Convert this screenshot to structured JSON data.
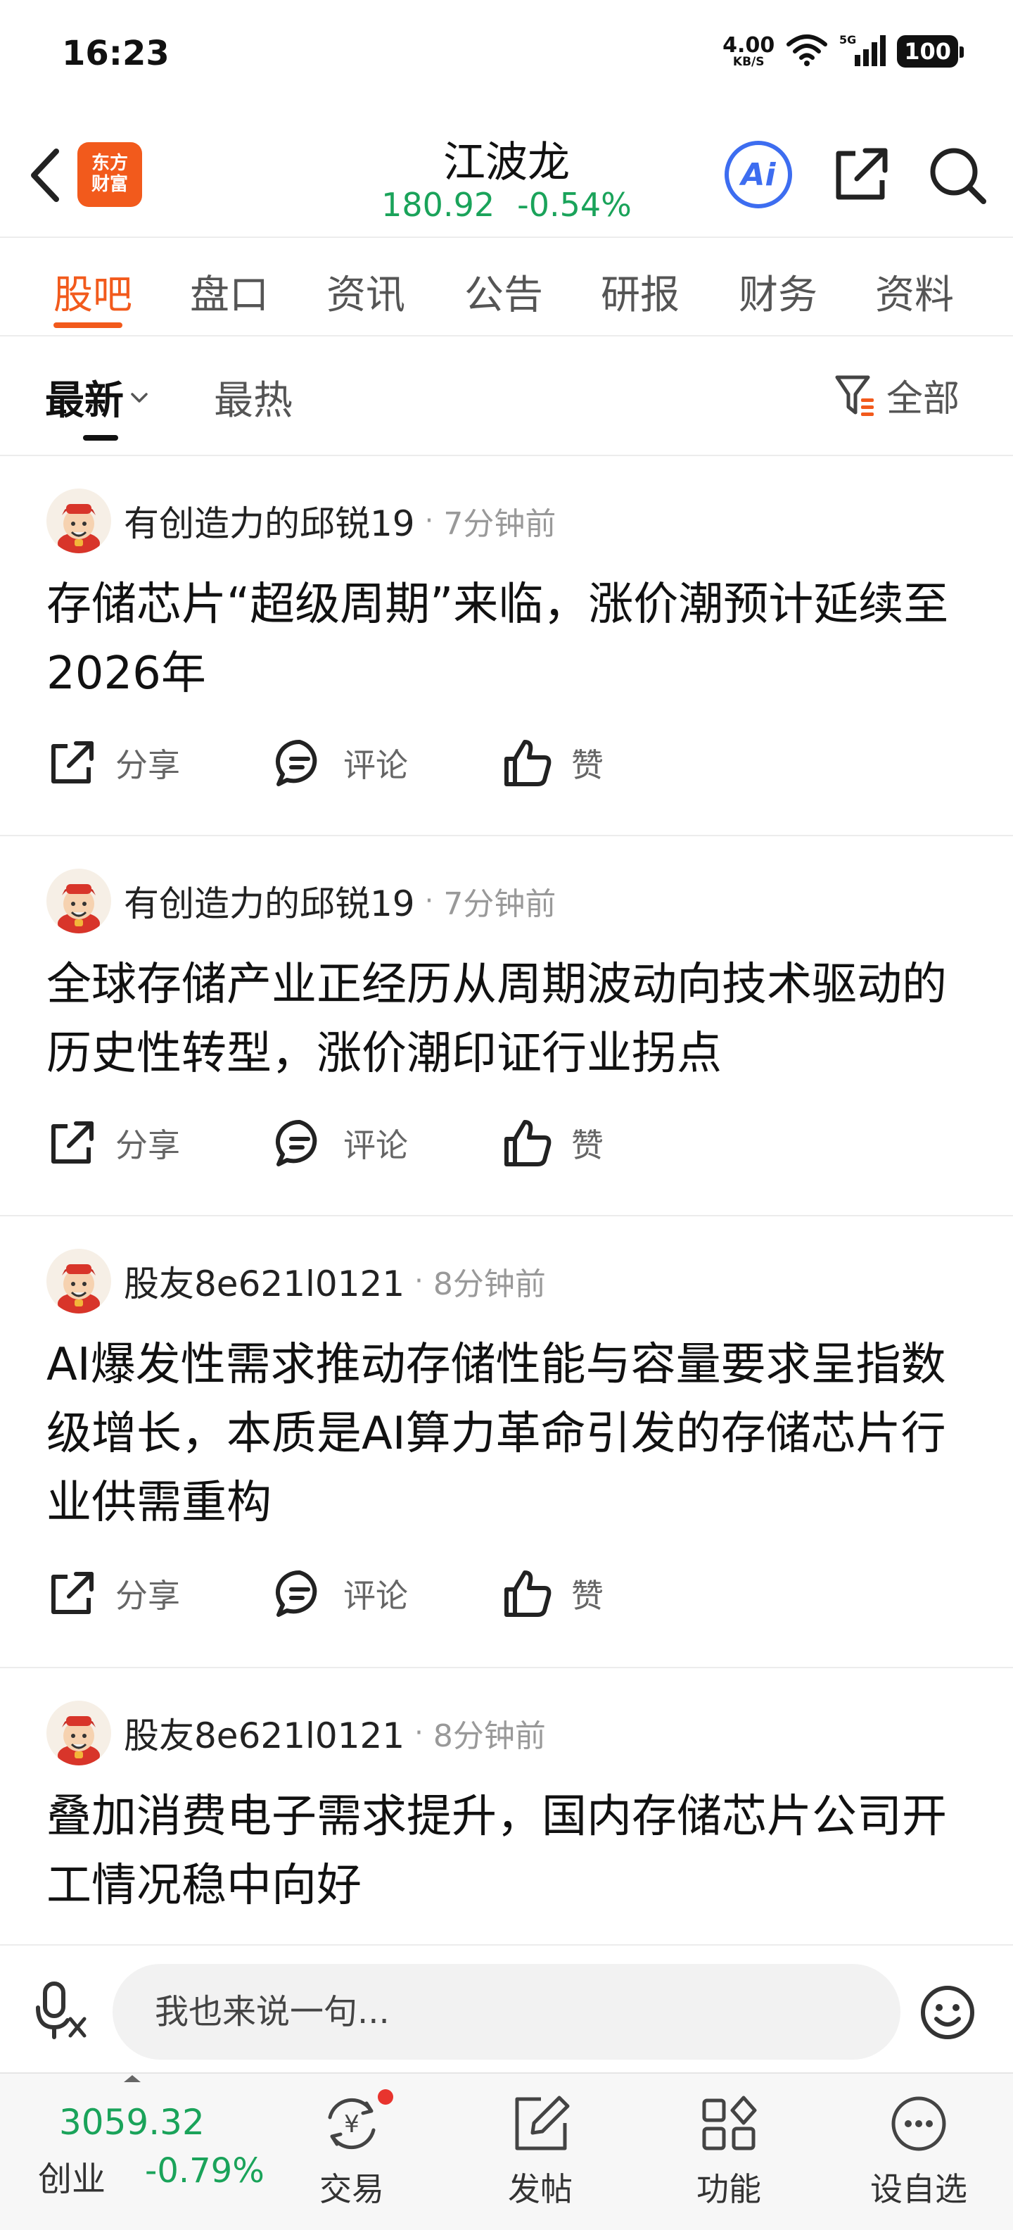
{
  "status_bar": {
    "time": "16:23",
    "net_speed_value": "4.00",
    "net_speed_unit": "KB/S",
    "signal_label": "5G",
    "battery": "100"
  },
  "header": {
    "logo_line1": "东方",
    "logo_line2": "财富",
    "stock_name": "江波龙",
    "price": "180.92",
    "change_pct": "-0.54%",
    "ai_label": "Ai"
  },
  "tabs": [
    "股吧",
    "盘口",
    "资讯",
    "公告",
    "研报",
    "财务",
    "资料"
  ],
  "sort": {
    "latest": "最新",
    "hot": "最热",
    "filter": "全部"
  },
  "posts": [
    {
      "author": "有创造力的邱锐19",
      "time": "7分钟前",
      "content": "存储芯片“超级周期”来临，涨价潮预计延续至2026年"
    },
    {
      "author": "有创造力的邱锐19",
      "time": "7分钟前",
      "content": "全球存储产业正经历从周期波动向技术驱动的历史性转型，涨价潮印证行业拐点"
    },
    {
      "author": "股友8e621l0121",
      "time": "8分钟前",
      "content": "AI爆发性需求推动存储性能与容量要求呈指数级增长，本质是AI算力革命引发的存储芯片行业供需重构"
    },
    {
      "author": "股友8e621l0121",
      "time": "8分钟前",
      "content": "叠加消费电子需求提升，国内存储芯片公司开工情况稳中向好"
    }
  ],
  "actions": {
    "share": "分享",
    "comment": "评论",
    "like": "赞"
  },
  "comment_bar": {
    "placeholder": "我也来说一句..."
  },
  "bottom_nav": {
    "index_value": "3059.32",
    "index_name": "创业",
    "index_change": "-0.79%",
    "trade": "交易",
    "post": "发帖",
    "functions": "功能",
    "watchlist": "设自选"
  },
  "colors": {
    "accent": "#f25a1c",
    "down_green": "#1aa35a",
    "ai_blue": "#3d6df0"
  }
}
